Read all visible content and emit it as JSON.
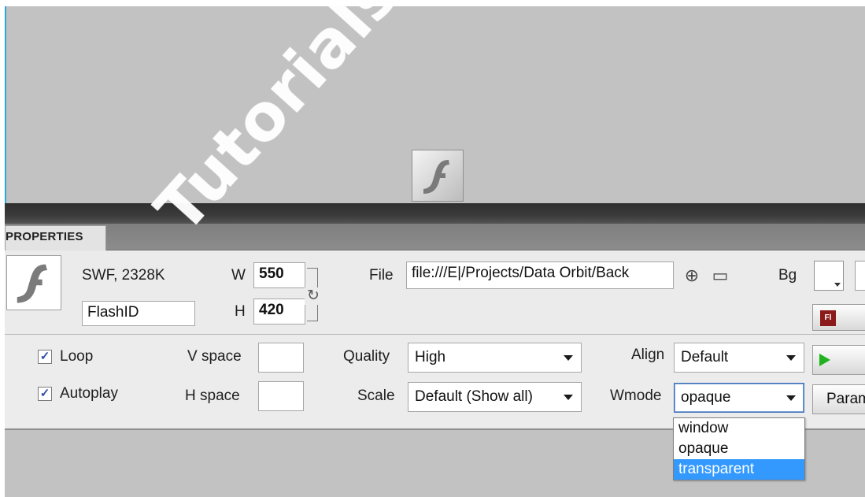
{
  "panel": {
    "tab_label": "PROPERTIES"
  },
  "object": {
    "type_size": "SWF, 2328K",
    "id_value": "FlashID",
    "w_label": "W",
    "w_value": "550",
    "h_label": "H",
    "h_value": "420",
    "file_label": "File",
    "file_value": "file:///E|/Projects/Data Orbit/Back",
    "bg_label": "Bg"
  },
  "options": {
    "loop_label": "Loop",
    "loop_checked": true,
    "autoplay_label": "Autoplay",
    "autoplay_checked": true,
    "vspace_label": "V space",
    "vspace_value": "",
    "hspace_label": "H space",
    "hspace_value": "",
    "quality_label": "Quality",
    "quality_value": "High",
    "scale_label": "Scale",
    "scale_value": "Default (Show all)",
    "align_label": "Align",
    "align_value": "Default",
    "wmode_label": "Wmode",
    "wmode_value": "opaque",
    "param_label": "Param"
  },
  "wmode_dropdown": {
    "options": [
      "window",
      "opaque",
      "transparent"
    ],
    "highlighted": "transparent"
  },
  "watermark": "Tutorials Palace",
  "colors": {
    "canvas": "#c2c2c2",
    "selection": "#3399ff",
    "canvas_edge": "#27a9e1"
  },
  "icons": [
    "flash-icon",
    "point-to-file-icon",
    "folder-icon",
    "reset-size-icon",
    "play-icon",
    "flash-edit-icon"
  ]
}
